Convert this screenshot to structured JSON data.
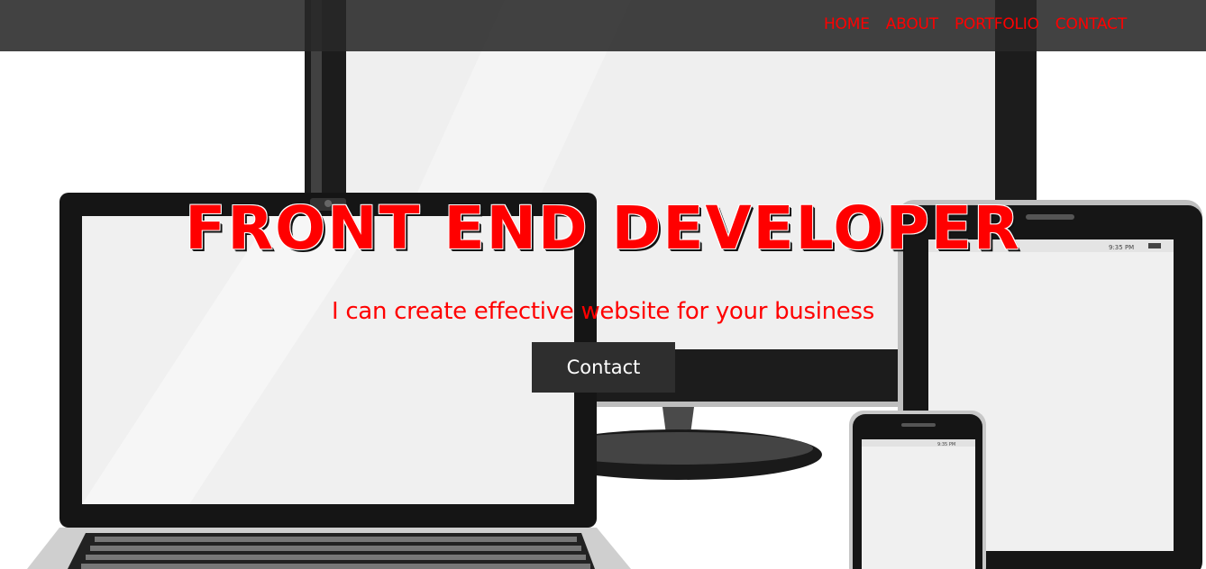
{
  "nav": {
    "links": [
      "HOME",
      "ABOUT",
      "PORTFOLIO",
      "CONTACT"
    ]
  },
  "hero": {
    "title": "FRONT END DEVELOPER",
    "subtitle": "I can create effective website for your business",
    "cta_label": "Contact"
  },
  "colors": {
    "accent": "#ff0000",
    "navbar": "#3a3a3a",
    "button": "#2e2e2e",
    "button_text": "#ffffff"
  },
  "background_image": "devices-illustration"
}
